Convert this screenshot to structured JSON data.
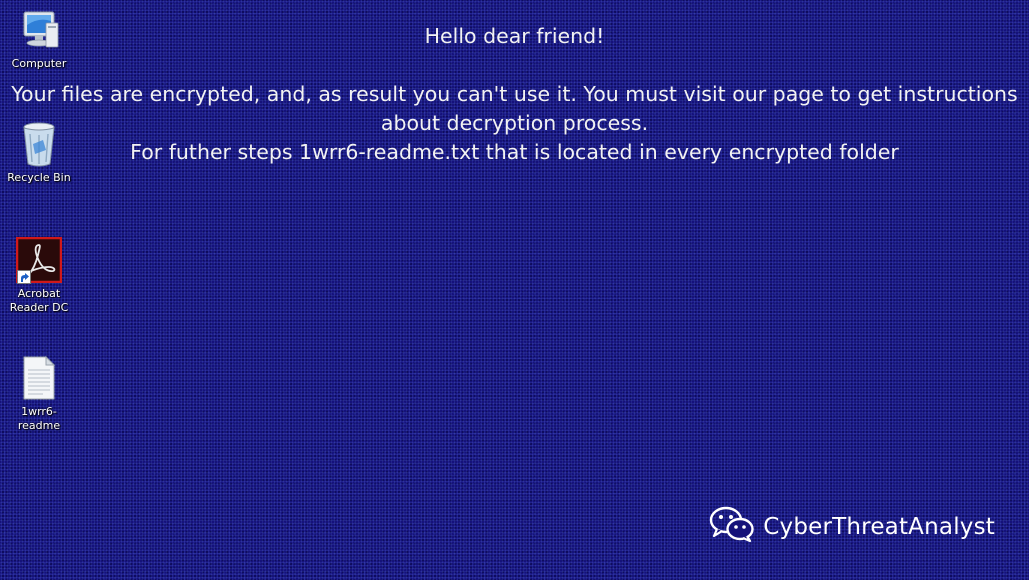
{
  "desktop": {
    "background_color": "#15127a",
    "icons": [
      {
        "name": "computer",
        "label": "Computer",
        "icon": "computer-icon"
      },
      {
        "name": "recycle-bin",
        "label": "Recycle Bin",
        "icon": "recycle-bin-icon"
      },
      {
        "name": "acrobat-reader-dc",
        "label": "Acrobat\nReader DC",
        "icon": "acrobat-icon",
        "accent": "#d0191b"
      },
      {
        "name": "readme-file",
        "label": "1wrr6-readme",
        "icon": "text-file-icon"
      }
    ]
  },
  "ransom_note": {
    "greeting": "Hello dear friend!",
    "line1": "Your files are encrypted, and, as result you can't use it. You must visit our page to get instructions",
    "line2": "about decryption process.",
    "line3": "For futher steps 1wrr6-readme.txt that is located in every encrypted folder"
  },
  "watermark": {
    "text": "CyberThreatAnalyst",
    "icon": "wechat-icon"
  }
}
